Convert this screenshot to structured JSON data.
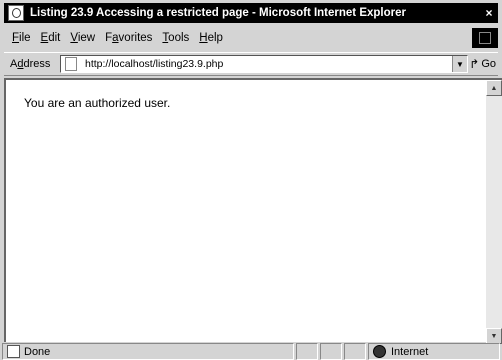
{
  "window": {
    "title": "Listing 23.9 Accessing a restricted page - Microsoft Internet Explorer",
    "close_glyph": "×"
  },
  "menu": {
    "items": [
      {
        "key": "F",
        "rest": "ile"
      },
      {
        "key": "E",
        "rest": "dit"
      },
      {
        "key": "V",
        "rest": "iew"
      },
      {
        "key": "a",
        "pre": "F",
        "rest": "vorites"
      },
      {
        "key": "T",
        "rest": "ools"
      },
      {
        "key": "H",
        "rest": "elp"
      }
    ]
  },
  "address": {
    "label_key": "d",
    "label_pre": "A",
    "label_rest": "dress",
    "url": "http://localhost/listing23.9.php",
    "go_label": "Go"
  },
  "page": {
    "text": "You are an authorized user."
  },
  "status": {
    "text": "Done",
    "zone": "Internet"
  },
  "icons": {
    "app": "ie-page-icon",
    "brand": "ie-logo-icon",
    "page": "page-icon",
    "dropdown": "dropdown-arrow-icon",
    "go": "go-arrow-icon",
    "scroll_up": "scroll-up-icon",
    "scroll_down": "scroll-down-icon",
    "done": "done-page-icon",
    "zone": "globe-icon"
  }
}
